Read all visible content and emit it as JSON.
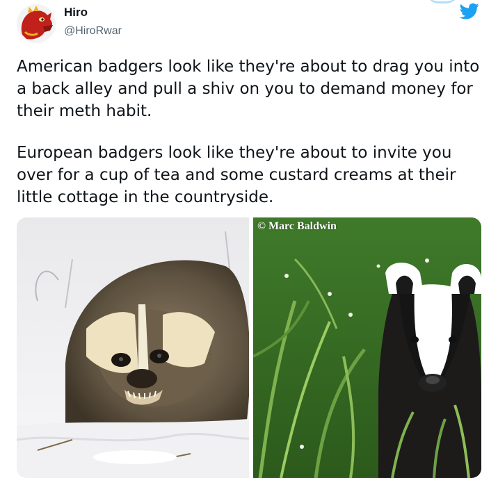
{
  "author": {
    "display_name": "Hiro",
    "handle": "@HiroRwar",
    "avatar_icon": "red-dragon-avatar"
  },
  "platform_icon": "twitter-bird-icon",
  "accent_color": "#1da1f2",
  "tweet": {
    "paragraphs": [
      "American badgers look like they're about to drag you into a back alley and pull a shiv on you to demand money for their meth habit.",
      "European badgers look like they're about to invite you over for a cup of tea and some custard creams at their little cottage in the countryside."
    ]
  },
  "media": {
    "left_photo": "American badger snarling in snow",
    "right_photo": "European badger in green grass",
    "watermark": "© Marc Baldwin"
  }
}
